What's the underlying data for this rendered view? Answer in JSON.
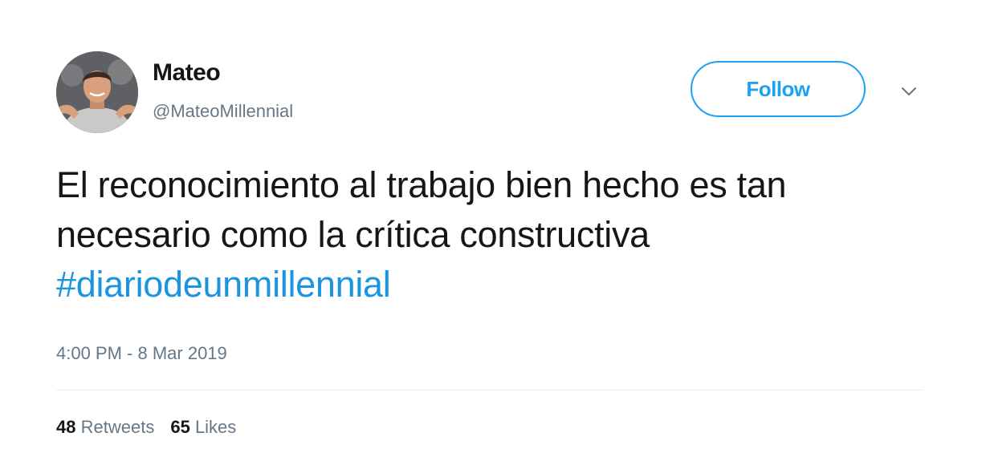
{
  "user": {
    "display_name": "Mateo",
    "handle": "@MateoMillennial"
  },
  "follow_button": {
    "label": "Follow"
  },
  "icons": {
    "menu": "chevron-down-icon",
    "avatar": "avatar-photo"
  },
  "tweet": {
    "text": "El reconocimiento al trabajo bien hecho es tan necesario como la crítica constructiva",
    "hashtag": "#diariodeunmillennial",
    "timestamp": "4:00 PM - 8 Mar 2019"
  },
  "stats": {
    "retweets_count": "48",
    "retweets_label": "Retweets",
    "likes_count": "65",
    "likes_label": "Likes"
  },
  "colors": {
    "accent": "#1da1f2",
    "hashtag": "#1b95e0",
    "text": "#14171a",
    "secondary": "#657786",
    "divider": "#e6ecf0"
  }
}
